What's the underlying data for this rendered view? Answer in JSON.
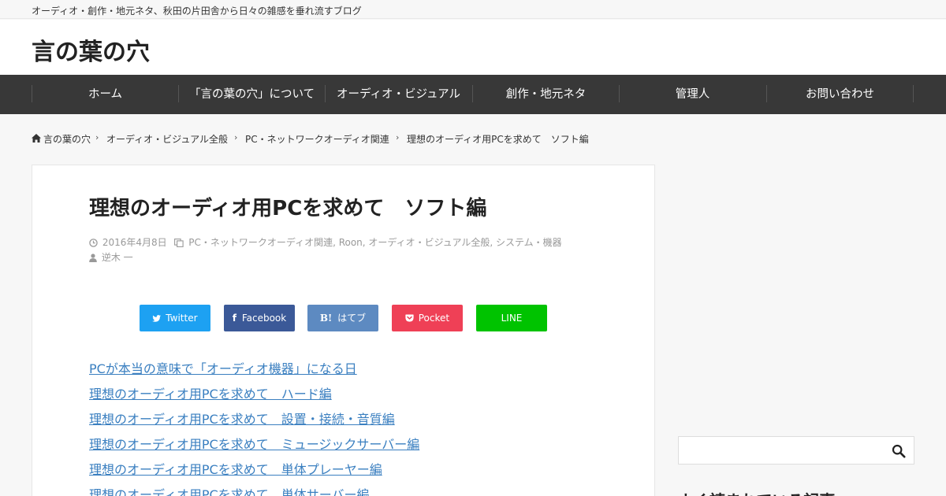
{
  "topbar": {
    "tagline": "オーディオ・創作・地元ネタ、秋田の片田舎から日々の雑感を垂れ流すブログ"
  },
  "header": {
    "site_title": "言の葉の穴"
  },
  "gnav": {
    "items": [
      {
        "label": "ホーム"
      },
      {
        "label": "「言の葉の穴」について"
      },
      {
        "label": "オーディオ・ビジュアル"
      },
      {
        "label": "創作・地元ネタ"
      },
      {
        "label": "管理人"
      },
      {
        "label": "お問い合わせ"
      }
    ]
  },
  "breadcrumb": {
    "items": [
      {
        "label": "言の葉の穴"
      },
      {
        "label": "オーディオ・ビジュアル全般"
      },
      {
        "label": "PC・ネットワークオーディオ関連"
      },
      {
        "label": "理想のオーディオ用PCを求めて　ソフト編"
      }
    ]
  },
  "article": {
    "title": "理想のオーディオ用PCを求めて　ソフト編",
    "date": "2016年4月8日",
    "categories": "PC・ネットワークオーディオ関連, Roon, オーディオ・ビジュアル全般, システム・機器",
    "author": "逆木 一"
  },
  "share": {
    "buttons": [
      {
        "label": "Twitter",
        "icon": "twitter-icon",
        "color": "#1da1f2"
      },
      {
        "label": "Facebook",
        "icon": "facebook-icon",
        "color": "#3b5998"
      },
      {
        "label": "はてブ",
        "icon": "hatena-icon",
        "color": "#5d8ac1"
      },
      {
        "label": "Pocket",
        "icon": "pocket-icon",
        "color": "#ef4056"
      },
      {
        "label": "LINE",
        "icon": "line-icon",
        "color": "#00c300"
      }
    ]
  },
  "related_links": [
    {
      "label": "PCが本当の意味で「オーディオ機器」になる日"
    },
    {
      "label": "理想のオーディオ用PCを求めて　ハード編"
    },
    {
      "label": "理想のオーディオ用PCを求めて　設置・接続・音質編"
    },
    {
      "label": "理想のオーディオ用PCを求めて　ミュージックサーバー編"
    },
    {
      "label": "理想のオーディオ用PCを求めて　単体プレーヤー編"
    },
    {
      "label": "理想のオーディオ用PCを求めて　単体サーバー編"
    }
  ],
  "sidebar": {
    "search_icon": "search-icon",
    "widget_title": "よく読まれている記事"
  }
}
